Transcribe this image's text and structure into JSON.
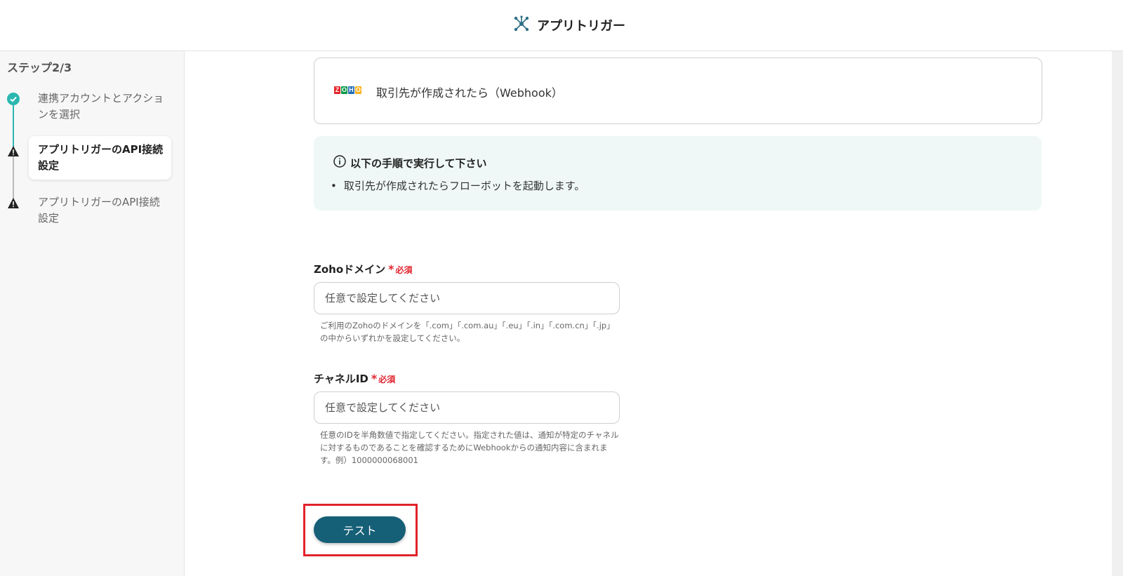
{
  "header": {
    "title": "アプリトリガー",
    "icon": "network-icon"
  },
  "sidebar": {
    "step_label": "ステップ2/3",
    "steps": [
      {
        "label": "連携アカウントとアクションを選択",
        "status": "complete"
      },
      {
        "label": "アプリトリガーのAPI接続設定",
        "status": "current"
      },
      {
        "label": "アプリトリガーのAPI接続設定",
        "status": "warning"
      }
    ]
  },
  "trigger": {
    "label": "取引先が作成されたら（Webhook）",
    "logo_letters": [
      "Z",
      "O",
      "H",
      "O"
    ]
  },
  "info": {
    "title": "以下の手順で実行して下さい",
    "items": [
      "取引先が作成されたらフローボットを起動します。"
    ]
  },
  "fields": {
    "domain": {
      "label": "Zohoドメイン",
      "required": "必須",
      "placeholder": "任意で設定してください",
      "help": "ご利用のZohoのドメインを「.com」「.com.au」「.eu」「.in」「.com.cn」「.jp」の中からいずれかを設定してください。"
    },
    "channel": {
      "label": "チャネルID",
      "required": "必須",
      "placeholder": "任意で設定してください",
      "help": "任意のIDを半角数値で指定してください。指定された値は、通知が特定のチャネルに対するものであることを確認するためにWebhookからの通知内容に含まれます。例）1000000068001"
    }
  },
  "actions": {
    "test_label": "テスト"
  },
  "colors": {
    "accent": "#2ab7b0",
    "button": "#155f77",
    "highlight": "#e1232a",
    "required": "#e0242e",
    "info_bg": "#eff8f7"
  }
}
